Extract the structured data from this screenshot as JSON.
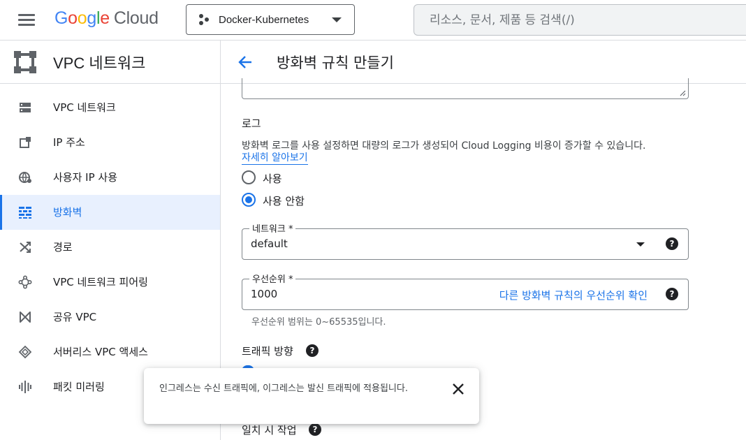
{
  "topbar": {
    "logo_letters": [
      "G",
      "o",
      "o",
      "g",
      "l",
      "e"
    ],
    "logo_suffix": "Cloud",
    "project_name": "Docker-Kubernetes",
    "search_placeholder": "리소스, 문서, 제품 등 검색(/)"
  },
  "sidebar": {
    "title": "VPC 네트워크",
    "items": [
      {
        "label": "VPC 네트워크",
        "icon": "vpc-network-icon",
        "active": false
      },
      {
        "label": "IP 주소",
        "icon": "ip-address-icon",
        "active": false
      },
      {
        "label": "사용자 IP 사용",
        "icon": "globe-icon",
        "active": false
      },
      {
        "label": "방화벽",
        "icon": "firewall-icon",
        "active": true
      },
      {
        "label": "경로",
        "icon": "routes-icon",
        "active": false
      },
      {
        "label": "VPC 네트워크 피어링",
        "icon": "peering-icon",
        "active": false
      },
      {
        "label": "공유 VPC",
        "icon": "shared-vpc-icon",
        "active": false
      },
      {
        "label": "서버리스 VPC 액세스",
        "icon": "serverless-icon",
        "active": false
      },
      {
        "label": "패킷 미러링",
        "icon": "packet-mirroring-icon",
        "active": false
      }
    ]
  },
  "main": {
    "title": "방화벽 규칙 만들기",
    "logs": {
      "heading": "로그",
      "description": "방화벽 로그를 사용 설정하면 대량의 로그가 생성되어 Cloud Logging 비용이 증가할 수 있습니다.",
      "learn_more": "자세히 알아보기",
      "option_on": "사용",
      "option_off": "사용 안함",
      "selected": "사용 안함"
    },
    "network": {
      "label": "네트워크 *",
      "value": "default"
    },
    "priority": {
      "label": "우선순위 *",
      "value": "1000",
      "link": "다른 방화벽 규칙의 우선순위 확인",
      "hint": "우선순위 범위는 0~65535입니다."
    },
    "traffic_direction": {
      "heading": "트래픽 방향"
    },
    "action_on_match": {
      "heading": "일치 시 작업"
    }
  },
  "toast": {
    "message": "인그레스는 수신 트래픽에, 이그레스는 발신 트래픽에 적용됩니다."
  },
  "colors": {
    "accent": "#1a73e8",
    "active_bg": "#e8f0fe",
    "border": "#dadce0"
  }
}
